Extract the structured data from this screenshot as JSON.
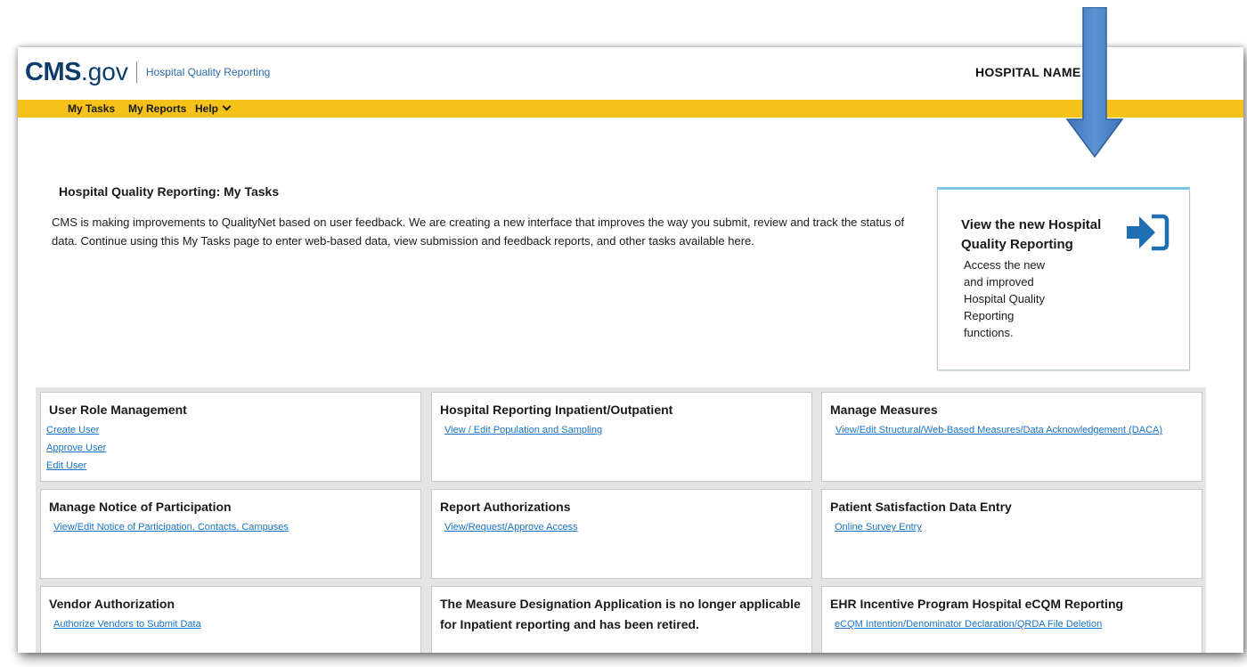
{
  "header": {
    "logo_main": "CMS",
    "logo_sub": ".gov",
    "app_name": "Hospital Quality Reporting",
    "hospital_name": "HOSPITAL NAME"
  },
  "nav": {
    "my_tasks": "My Tasks",
    "my_reports": "My Reports",
    "help": "Help"
  },
  "page": {
    "title": "Hospital Quality Reporting: My Tasks",
    "intro": "CMS is making improvements to QualityNet based on user feedback. We are creating a new interface that improves the way you submit, review and track the status of data. Continue using this My Tasks page to enter web-based data, view submission and feedback reports, and other tasks available here."
  },
  "callout": {
    "title": "View the new Hospital Quality Reporting",
    "description": "Access the new and improved Hospital Quality Reporting functions.",
    "icon": "sign-in-arrow-icon"
  },
  "cards": [
    {
      "title": "User Role Management",
      "links": [
        "Create User",
        "Approve User",
        "Edit User"
      ]
    },
    {
      "title": "Hospital Reporting Inpatient/Outpatient",
      "links": [
        "View / Edit Population and Sampling"
      ]
    },
    {
      "title": "Manage Measures",
      "links": [
        "View/Edit Structural/Web-Based Measures/Data Acknowledgement (DACA)"
      ]
    },
    {
      "title": "Manage Notice of Participation",
      "links": [
        "View/Edit Notice of Participation, Contacts, Campuses"
      ]
    },
    {
      "title": "Report Authorizations",
      "links": [
        "View/Request/Approve Access"
      ]
    },
    {
      "title": "Patient Satisfaction Data Entry",
      "links": [
        "Online Survey Entry"
      ]
    },
    {
      "title": "Vendor Authorization",
      "links": [
        "Authorize Vendors to Submit Data"
      ]
    },
    {
      "title": "The Measure Designation Application is no longer applicable for Inpatient reporting and has been retired.",
      "links": []
    },
    {
      "title": "EHR Incentive Program Hospital eCQM Reporting",
      "links": [
        "eCQM Intention/Denominator Declaration/QRDA File Deletion"
      ]
    }
  ],
  "colors": {
    "nav_bar": "#f4c21a",
    "logo": "#0c3d6b",
    "link": "#1a73c7",
    "callout_icon": "#1f6fb5",
    "annotation_arrow": "#4f86c6"
  }
}
